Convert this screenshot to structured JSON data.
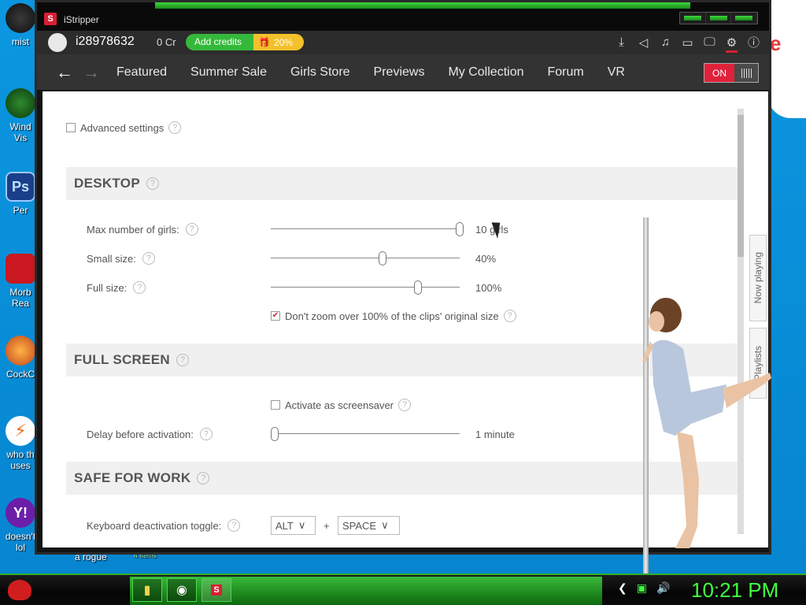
{
  "desktop": {
    "icons": [
      {
        "label": "mist",
        "top": 0
      },
      {
        "label": "Wind",
        "sub": "Vis"
      },
      {
        "label": "Per"
      },
      {
        "label": "Morb",
        "sub": "Rea"
      },
      {
        "label": "CockC"
      },
      {
        "label": "who th",
        "sub": "uses"
      },
      {
        "label": "doesn't",
        "sub": "lol"
      }
    ],
    "caption": "a rogue",
    "caption2": "4 items"
  },
  "taskbar": {
    "time": "10:21 PM"
  },
  "app": {
    "title": "iStripper",
    "logo_letter": "S",
    "account": {
      "username": "i28978632",
      "credits": "0 Cr",
      "add_credits_label": "Add credits",
      "discount": "20%"
    },
    "nav": {
      "back_glyph": "←",
      "forward_glyph": "→",
      "links": [
        "Featured",
        "Summer Sale",
        "Girls Store",
        "Previews",
        "My Collection",
        "Forum",
        "VR"
      ],
      "toggle_label": "ON"
    },
    "settings": {
      "advanced_label": "Advanced settings",
      "desktop": {
        "heading": "DESKTOP",
        "max_girls_label": "Max number of girls:",
        "max_girls_value": "10 girls",
        "max_girls_fraction": 1.0,
        "small_size_label": "Small size:",
        "small_size_value": "40%",
        "small_size_fraction": 0.59,
        "full_size_label": "Full size:",
        "full_size_value": "100%",
        "full_size_fraction": 0.78,
        "dont_zoom_label": "Don't zoom over 100% of the clips' original size",
        "dont_zoom_checked": true
      },
      "fullscreen": {
        "heading": "FULL SCREEN",
        "screensaver_label": "Activate as screensaver",
        "screensaver_checked": false,
        "delay_label": "Delay before activation:",
        "delay_value": "1 minute",
        "delay_fraction": 0.02
      },
      "sfw": {
        "heading": "SAFE FOR WORK",
        "toggle_label": "Keyboard deactivation toggle:",
        "key1": "ALT",
        "plus": "+",
        "key2": "SPACE"
      },
      "side_tabs": [
        "Now playing",
        "Playlists"
      ]
    }
  },
  "colors": {
    "accent_red": "#e0213a",
    "add_credits_green": "#35b93a",
    "discount_yellow": "#f3c12b",
    "clock_green": "#3fff3f"
  }
}
